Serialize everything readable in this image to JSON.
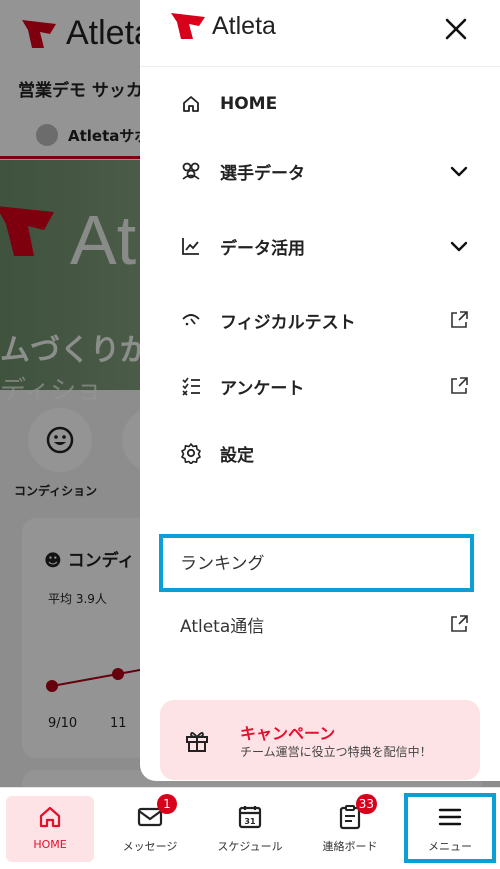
{
  "brand": {
    "name": "Atleta",
    "color": "#d9001b"
  },
  "background": {
    "team_name": "営業デモ サッカ",
    "user_name": "Atletaサポ",
    "hero_tagline": "ムづくりが",
    "hero_sub": "ディショ",
    "quick_label": "コンディション",
    "card_title": "コンディ",
    "card_avg": "平均 3.9人",
    "chart_x": [
      "9/10",
      "11"
    ]
  },
  "drawer": {
    "items": [
      {
        "label": "HOME",
        "icon": "home-icon"
      },
      {
        "label": "選手データ",
        "icon": "players-icon",
        "right": "chevron-down-icon"
      },
      {
        "label": "データ活用",
        "icon": "chart-icon",
        "right": "chevron-down-icon"
      },
      {
        "label": "フィジカルテスト",
        "icon": "physical-icon",
        "right": "external-link-icon"
      },
      {
        "label": "アンケート",
        "icon": "survey-icon",
        "right": "external-link-icon"
      },
      {
        "label": "設定",
        "icon": "gear-icon"
      }
    ],
    "ranking_label": "ランキング",
    "news_label": "Atleta通信",
    "campaign_title": "キャンペーン",
    "campaign_sub": "チーム運営に役立つ特典を配信中！"
  },
  "nav": {
    "items": [
      {
        "label": "HOME",
        "icon": "home-icon",
        "active": true
      },
      {
        "label": "メッセージ",
        "icon": "mail-icon",
        "badge": "1"
      },
      {
        "label": "スケジュール",
        "icon": "calendar-icon"
      },
      {
        "label": "連絡ボード",
        "icon": "clipboard-icon",
        "badge": "33"
      },
      {
        "label": "メニュー",
        "icon": "hamburger-icon"
      }
    ],
    "calendar_day": "31"
  },
  "colors": {
    "accent": "#e3102e",
    "highlight": "#0aa0d3",
    "campaign_bg": "#fde3e6"
  }
}
